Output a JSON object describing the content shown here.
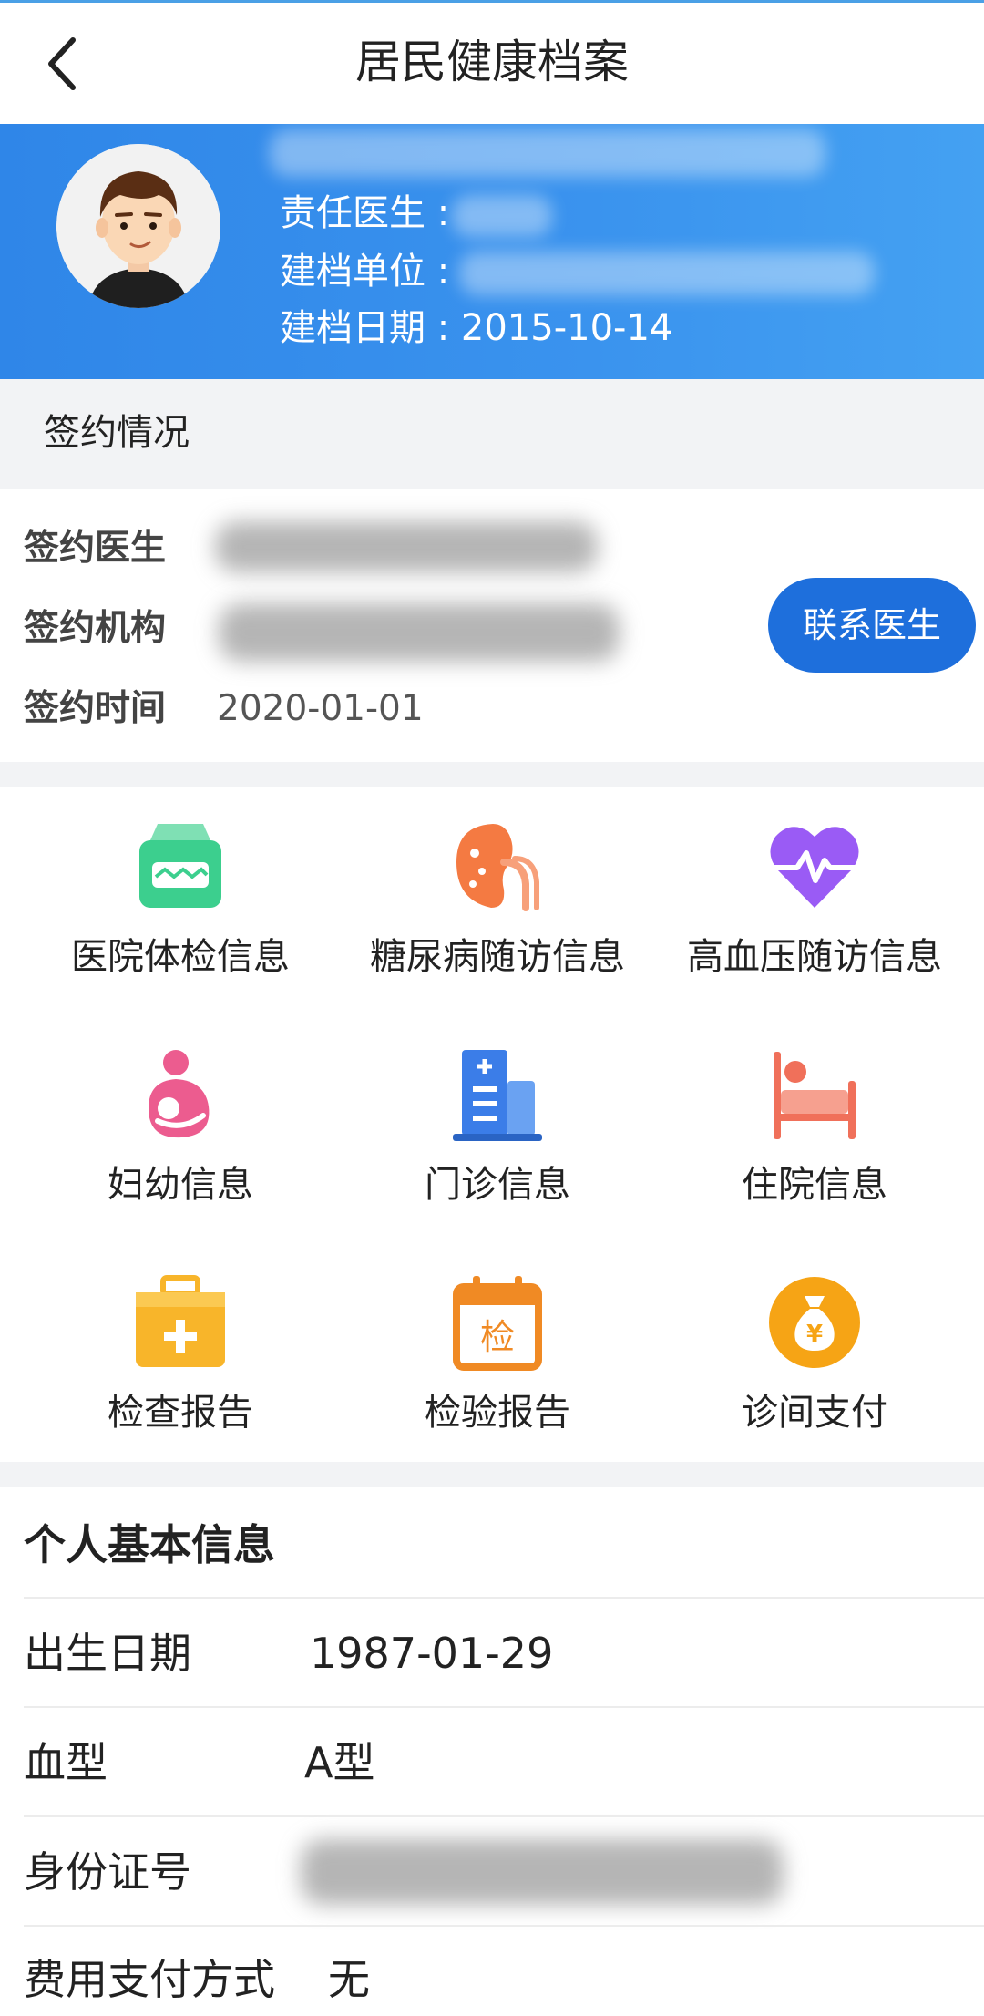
{
  "navbar": {
    "title": "居民健康档案"
  },
  "header": {
    "doctor_label": "责任医生 :",
    "unit_label": "建档单位 :",
    "date_line": "建档日期 : 2015-10-14"
  },
  "sign": {
    "section_title": "签约情况",
    "doctor_label": "签约医生",
    "org_label": "签约机构",
    "time_label": "签约时间",
    "time_value": "2020-01-01",
    "contact_button": "联系医生"
  },
  "grid": [
    {
      "label": "医院体检信息",
      "icon": "medical-kit-icon",
      "color": "#3ccf8e"
    },
    {
      "label": "糖尿病随访信息",
      "icon": "kidney-icon",
      "color": "#f47a42"
    },
    {
      "label": "高血压随访信息",
      "icon": "heartbeat-icon",
      "color": "#9a5bf5"
    },
    {
      "label": "妇幼信息",
      "icon": "mother-baby-icon",
      "color": "#ec5c8f"
    },
    {
      "label": "门诊信息",
      "icon": "hospital-building-icon",
      "color": "#3b7de8"
    },
    {
      "label": "住院信息",
      "icon": "hospital-bed-icon",
      "color": "#f0705a"
    },
    {
      "label": "检查报告",
      "icon": "first-aid-box-icon",
      "color": "#f8b52a"
    },
    {
      "label": "检验报告",
      "icon": "lab-calendar-icon",
      "color": "#f08a24"
    },
    {
      "label": "诊间支付",
      "icon": "money-bag-icon",
      "color": "#f6a415"
    }
  ],
  "calendar_badge": "检",
  "money_badge": "¥",
  "personal": {
    "title": "个人基本信息",
    "birth_label": "出生日期",
    "birth_value": "1987-01-29",
    "blood_label": "血型",
    "blood_value": "A型",
    "id_label": "身份证号",
    "pay_label": "费用支付方式",
    "pay_value": "无"
  }
}
